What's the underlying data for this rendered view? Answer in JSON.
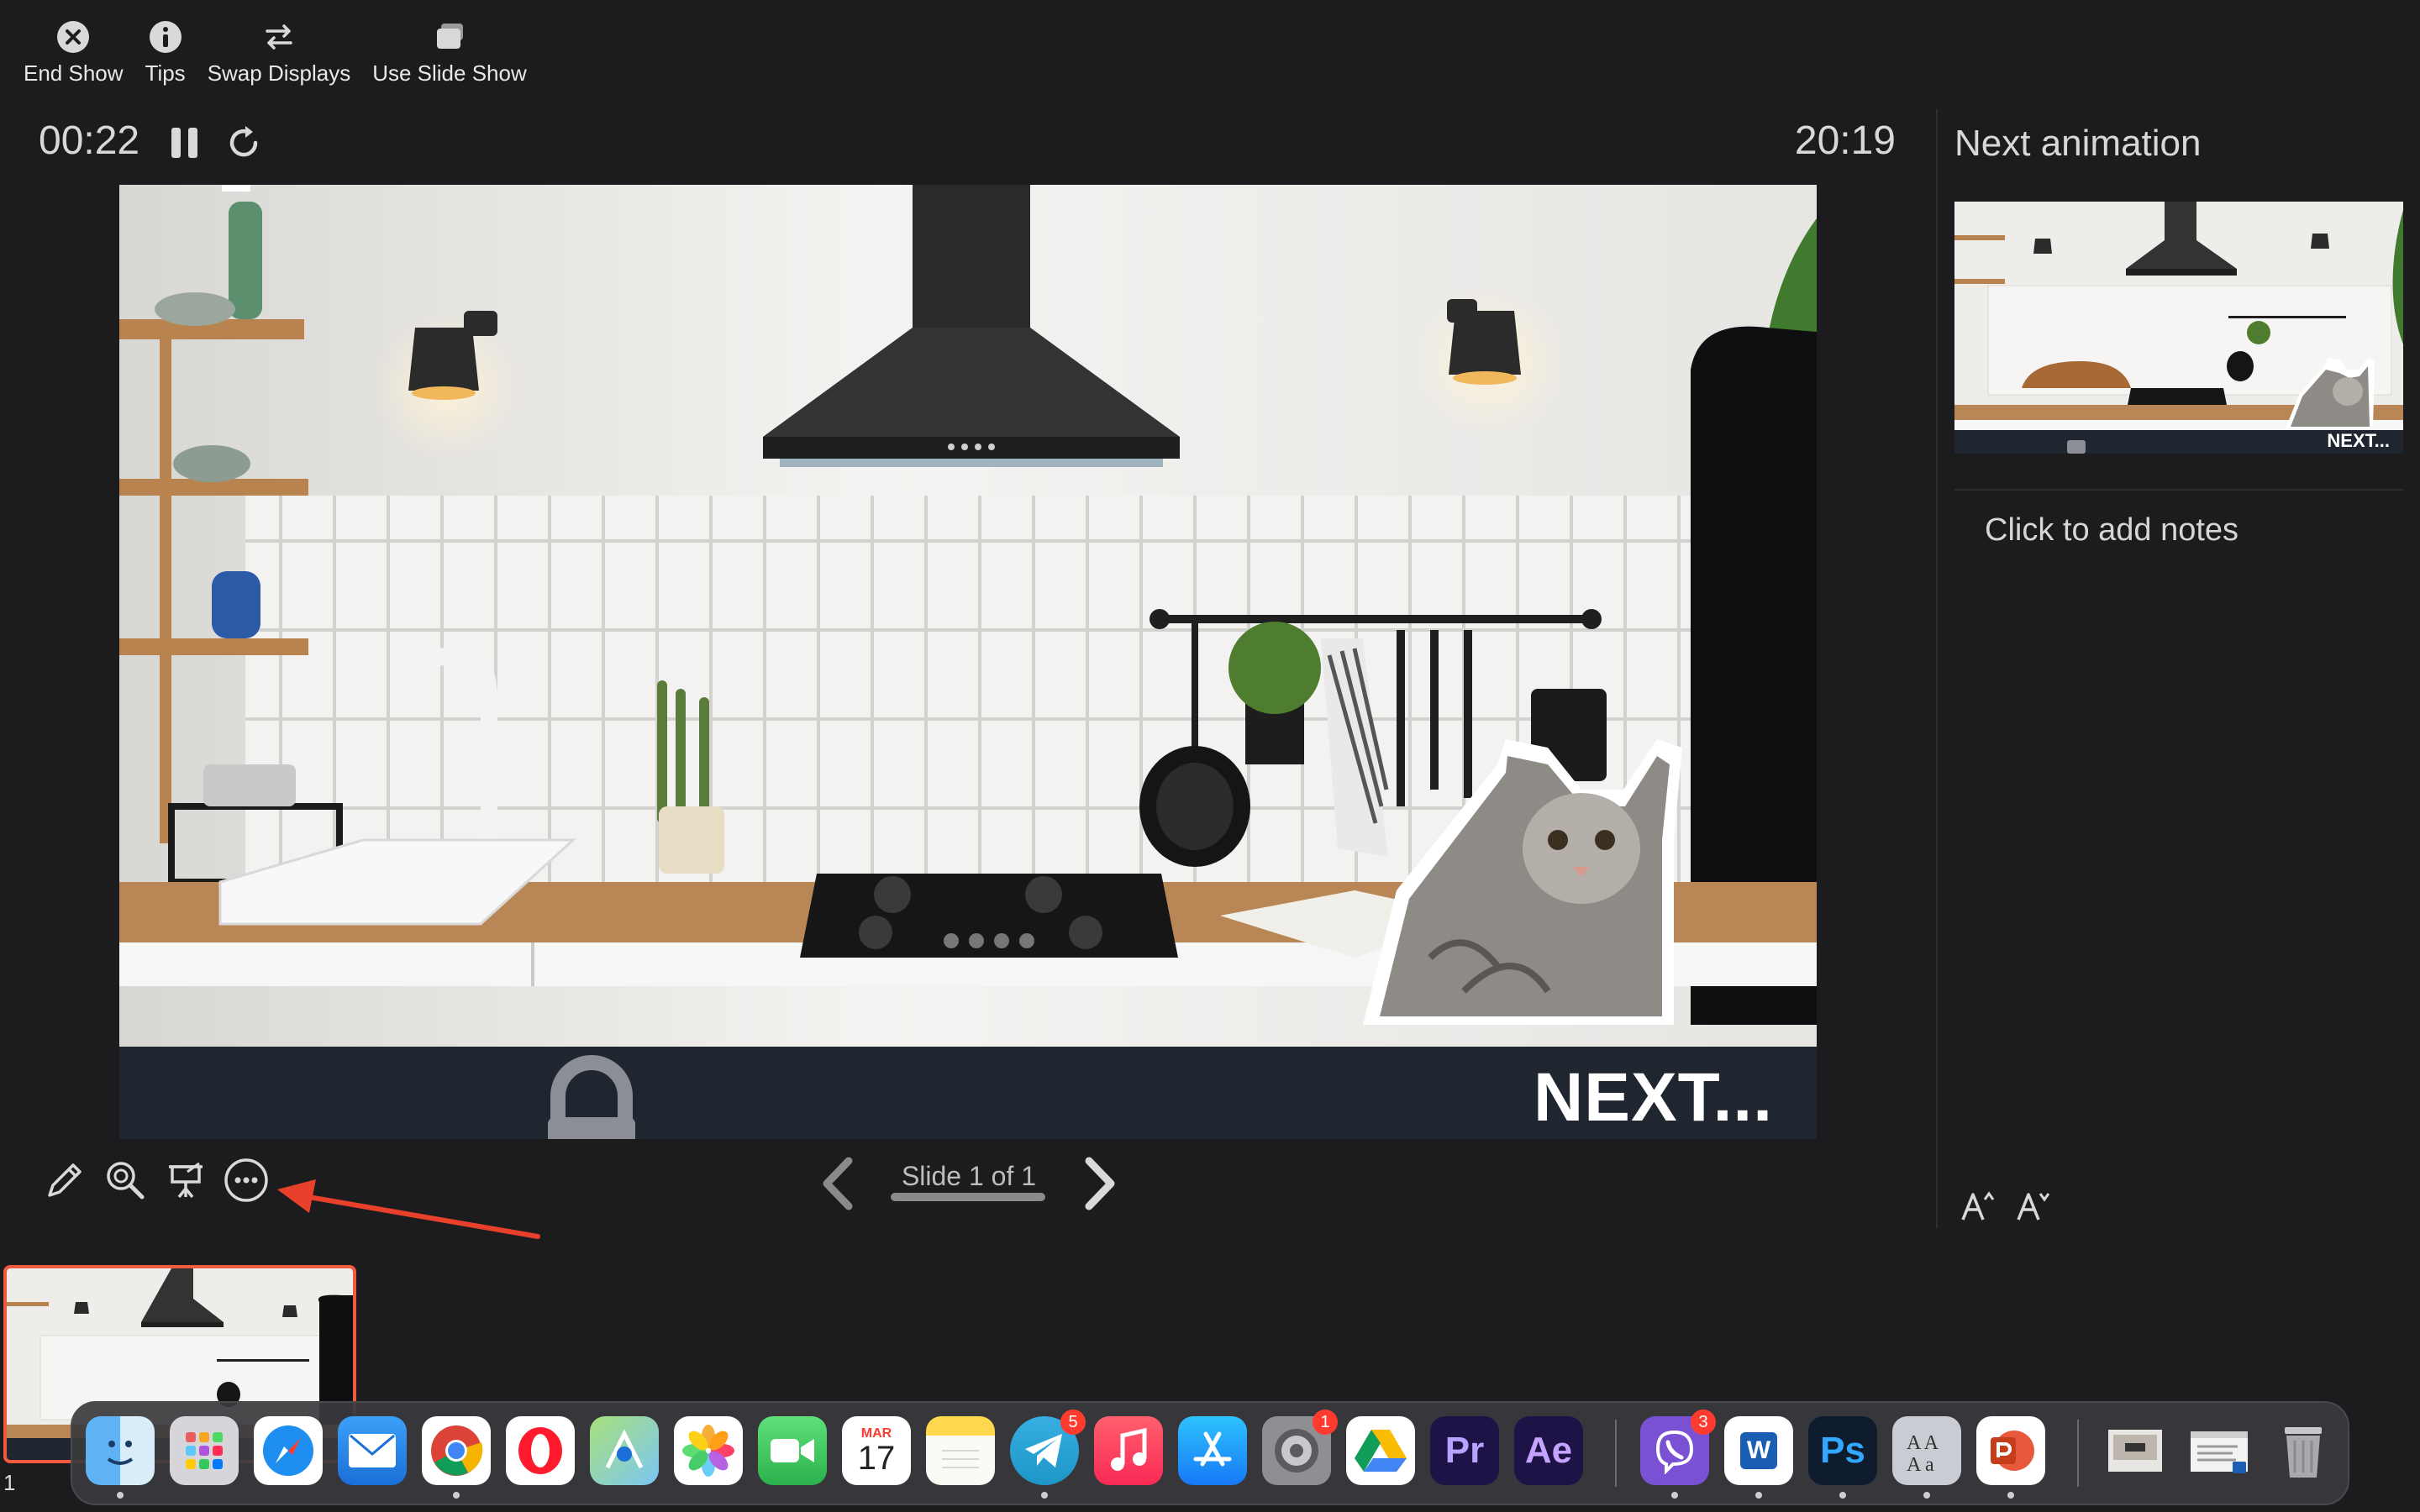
{
  "toolbar": {
    "end_show": "End Show",
    "tips": "Tips",
    "swap_displays": "Swap Displays",
    "use_slide_show": "Use Slide Show"
  },
  "timer": {
    "elapsed": "00:22",
    "clock": "20:19"
  },
  "slide": {
    "text": "NEXT..."
  },
  "navigation": {
    "counter": "Slide 1 of 1"
  },
  "panel": {
    "next_title": "Next animation",
    "notes_placeholder": "Click to add notes",
    "thumb_text": "NEXT..."
  },
  "filmstrip": {
    "number": "1"
  },
  "dock": {
    "calendar_month": "MAR",
    "calendar_day": "17",
    "telegram_badge": "5",
    "settings_badge": "1",
    "viber_badge": "3",
    "premiere_label": "Pr",
    "after_effects_label": "Ae",
    "photoshop_label": "Ps",
    "word_label": "W"
  },
  "colors": {
    "background": "#1c1c1e",
    "accent_red": "#f05a3f",
    "slide_bar": "#1f2630"
  }
}
